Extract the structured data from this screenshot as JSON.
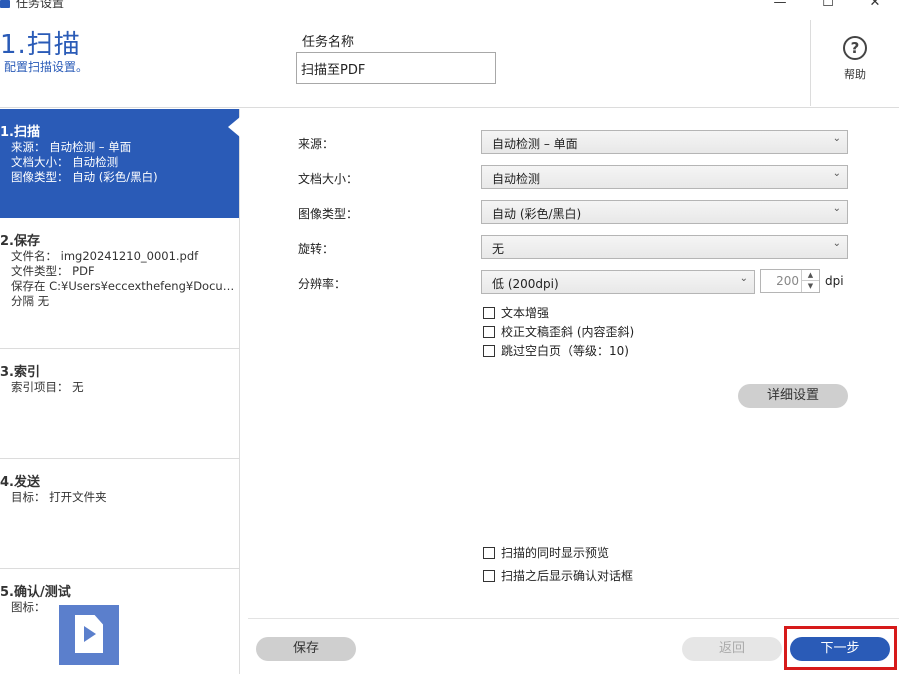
{
  "window": {
    "title": "任务设置",
    "controls": {
      "minimize": "—",
      "maximize": "☐",
      "close": "✕"
    }
  },
  "header": {
    "step_title": "1.扫描",
    "step_subtitle": "配置扫描设置。",
    "task_name_label": "任务名称",
    "task_name_value": "扫描至PDF",
    "help_label": "帮助",
    "help_glyph": "?"
  },
  "sidebar": {
    "items": [
      {
        "title": "1.扫描",
        "lines": [
          "来源： 自动检测 – 单面",
          "文档大小： 自动检测",
          "图像类型： 自动 (彩色/黑白)"
        ],
        "active": true
      },
      {
        "title": "2.保存",
        "lines": [
          "文件名： img20241210_0001.pdf",
          "文件类型： PDF",
          "保存在 C:¥Users¥eccexthefeng¥Documents",
          "分隔 无"
        ],
        "active": false
      },
      {
        "title": "3.索引",
        "lines": [
          "索引项目： 无"
        ],
        "active": false
      },
      {
        "title": "4.发送",
        "lines": [
          "目标： 打开文件夹"
        ],
        "active": false
      },
      {
        "title": "5.确认/测试",
        "lines": [
          "图标："
        ],
        "active": false
      }
    ]
  },
  "form": {
    "source_label": "来源：",
    "source_value": "自动检测 – 单面",
    "doc_size_label": "文档大小：",
    "doc_size_value": "自动检测",
    "image_type_label": "图像类型：",
    "image_type_value": "自动 (彩色/黑白)",
    "rotation_label": "旋转：",
    "rotation_value": "无",
    "resolution_label": "分辨率：",
    "resolution_value": "低 (200dpi)",
    "dpi_value": "200",
    "dpi_unit": "dpi",
    "checkboxes": [
      {
        "label": "文本增强",
        "checked": false
      },
      {
        "label": "校正文稿歪斜 (内容歪斜)",
        "checked": false
      },
      {
        "label": "跳过空白页（等级：10)",
        "checked": false
      }
    ],
    "detail_button": "详细设置",
    "preview_checkbox": "扫描的同时显示预览",
    "confirm_checkbox": "扫描之后显示确认对话框"
  },
  "footer": {
    "save_button": "保存",
    "back_button": "返回",
    "next_button": "下一步"
  },
  "colors": {
    "accent": "#2a5bb7",
    "highlight": "#d61a1a"
  }
}
